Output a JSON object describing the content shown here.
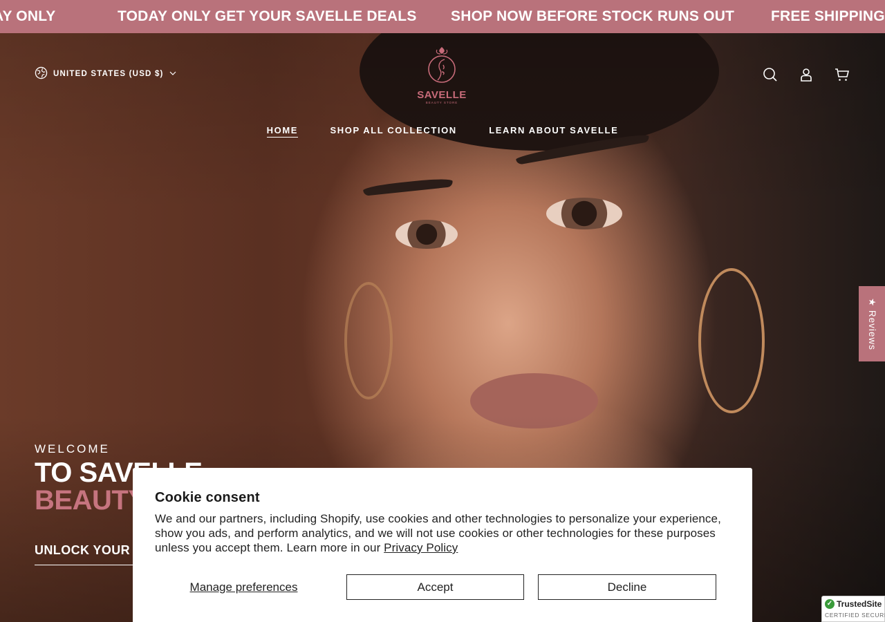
{
  "announcement": {
    "items": [
      "AY ONLY",
      "TODAY ONLY GET YOUR SAVELLE DEALS",
      "SHOP NOW BEFORE STOCK RUNS OUT",
      "FREE SHIPPING E"
    ]
  },
  "header": {
    "currency_label": "UNITED STATES (USD $)",
    "logo_text": "SAVELLE",
    "logo_subtext": "BEAUTY STORE",
    "icons": [
      "search-icon",
      "account-icon",
      "cart-icon"
    ]
  },
  "nav": {
    "items": [
      {
        "label": "HOME",
        "active": true
      },
      {
        "label": "SHOP ALL COLLECTION",
        "active": false
      },
      {
        "label": "LEARN ABOUT SAVELLE",
        "active": false
      }
    ]
  },
  "hero": {
    "eyebrow": "WELCOME",
    "title_line1": "TO SAVELLE",
    "title_line2": "BEAUTY",
    "cta_label": "UNLOCK YOUR BEAUTY"
  },
  "reviews_tab": {
    "label": "★ Reviews"
  },
  "cookie": {
    "title": "Cookie consent",
    "body": "We and our partners, including Shopify, use cookies and other technologies to personalize your experience, show you ads, and perform analytics, and we will not use cookies or other technologies for these purposes unless you accept them. Learn more in our",
    "privacy_link": "Privacy Policy",
    "manage_label": "Manage preferences",
    "accept_label": "Accept",
    "decline_label": "Decline"
  },
  "trusted_badge": {
    "title": "TrustedSite",
    "subtitle": "CERTIFIED SECURE"
  },
  "colors": {
    "brand_pink": "#b9727b",
    "accent_text_pink": "#c6747f"
  }
}
